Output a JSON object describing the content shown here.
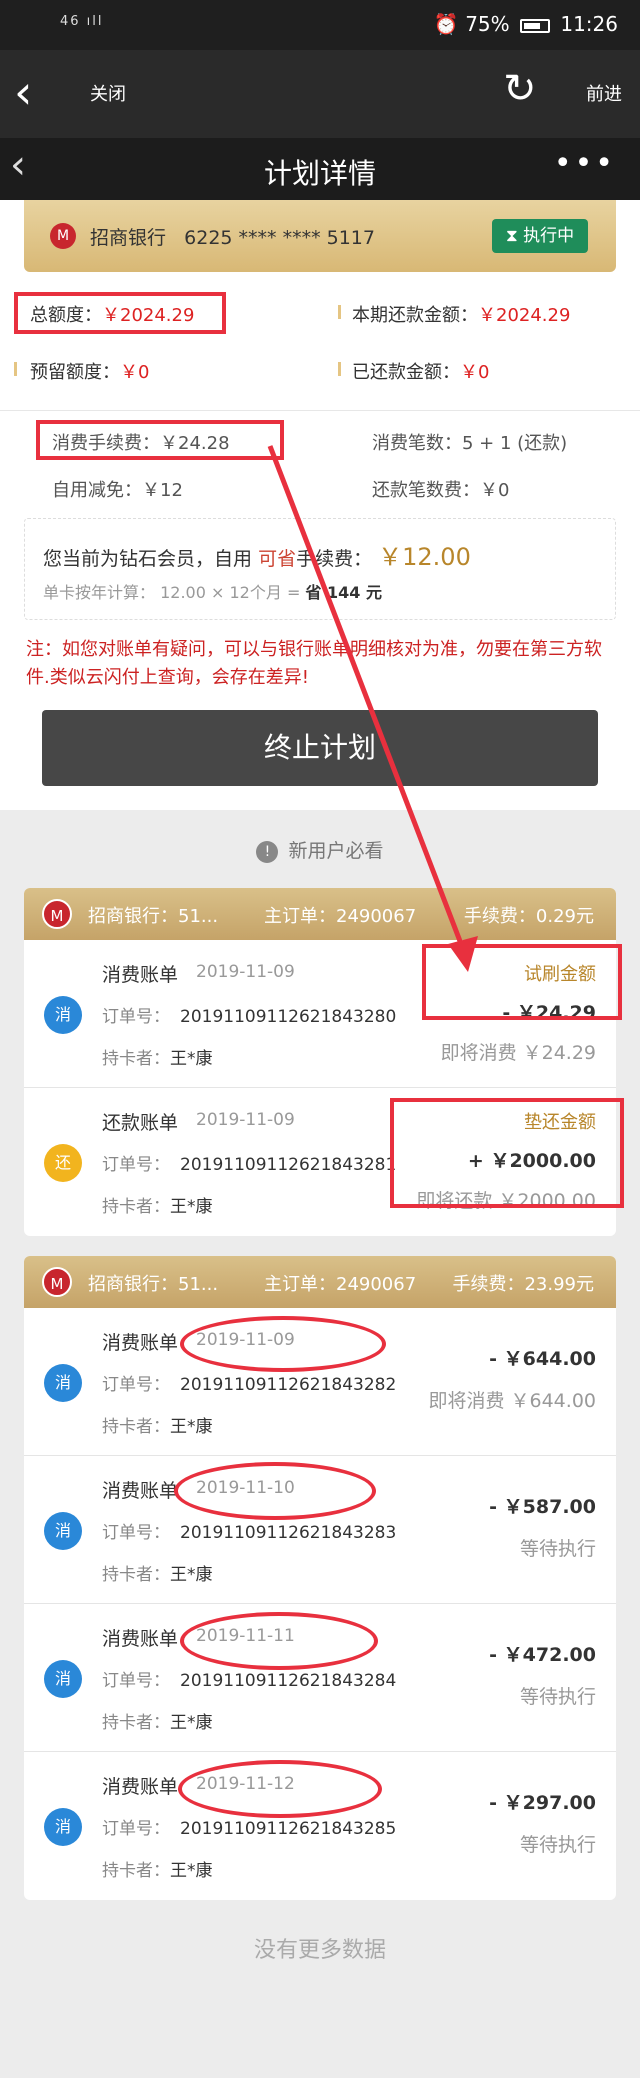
{
  "status_bar": {
    "signal": "46 ıll",
    "battery": "75%",
    "time": "11:26"
  },
  "browser": {
    "close": "关闭",
    "forward": "前进"
  },
  "header": {
    "title": "计划详情",
    "more": "•••"
  },
  "plan": {
    "bank_name": "招商银行",
    "card_number": "6225 **** **** 5117",
    "status": "执行中",
    "total_label": "总额度：",
    "total_value": "￥2024.29",
    "period_label": "本期还款金额：",
    "period_value": "￥2024.29",
    "reserve_label": "预留额度：",
    "reserve_value": "￥0",
    "repaid_label": "已还款金额：",
    "repaid_value": "￥0",
    "fee_label": "消费手续费：",
    "fee_value": "￥24.28",
    "count_label": "消费笔数：",
    "count_value": "5 + 1 (还款)",
    "self_label": "自用减免：",
    "self_value": "￥12",
    "repay_fee_label": "还款笔数费：",
    "repay_fee_value": "￥0"
  },
  "member": {
    "line1_a": "您当前为钻石会员，自用",
    "line1_b": "可省",
    "line1_c": "手续费：",
    "line1_amount": "￥12.00",
    "line2_a": "单卡按年计算：",
    "line2_b": "12.00 × 12个月 = ",
    "line2_c": "省 144 元"
  },
  "note": "注：如您对账单有疑问，可以与银行账单明细核对为准，勿要在第三方软件.类似云闪付上查询，会存在差异!",
  "stop_button": "终止计划",
  "new_user": "新用户必看",
  "groups": [
    {
      "bank": "招商银行：51...",
      "order": "主订单：2490067",
      "fee": "手续费：0.29元",
      "rows": [
        {
          "icon": "消",
          "title": "消费账单",
          "date": "2019-11-09",
          "order_label": "订单号：",
          "order": "20191109112621843280",
          "holder_label": "持卡者：",
          "holder": "王*康",
          "label": "试刷金额",
          "amount": "- ￥24.29",
          "sub": "即将消费 ￥24.29"
        },
        {
          "icon": "还",
          "title": "还款账单",
          "date": "2019-11-09",
          "order_label": "订单号：",
          "order": "20191109112621843281",
          "holder_label": "持卡者：",
          "holder": "王*康",
          "label": "垫还金额",
          "amount": "+ ￥2000.00",
          "sub": "即将还款 ￥2000.00"
        }
      ]
    },
    {
      "bank": "招商银行：51...",
      "order": "主订单：2490067",
      "fee": "手续费：23.99元",
      "rows": [
        {
          "icon": "消",
          "title": "消费账单",
          "date": "2019-11-09",
          "order_label": "订单号：",
          "order": "20191109112621843282",
          "holder_label": "持卡者：",
          "holder": "王*康",
          "amount": "- ￥644.00",
          "sub": "即将消费 ￥644.00"
        },
        {
          "icon": "消",
          "title": "消费账单",
          "date": "2019-11-10",
          "order_label": "订单号：",
          "order": "20191109112621843283",
          "holder_label": "持卡者：",
          "holder": "王*康",
          "amount": "- ￥587.00",
          "sub": "等待执行"
        },
        {
          "icon": "消",
          "title": "消费账单",
          "date": "2019-11-11",
          "order_label": "订单号：",
          "order": "20191109112621843284",
          "holder_label": "持卡者：",
          "holder": "王*康",
          "amount": "- ￥472.00",
          "sub": "等待执行"
        },
        {
          "icon": "消",
          "title": "消费账单",
          "date": "2019-11-12",
          "order_label": "订单号：",
          "order": "20191109112621843285",
          "holder_label": "持卡者：",
          "holder": "王*康",
          "amount": "- ￥297.00",
          "sub": "等待执行"
        }
      ]
    }
  ],
  "no_more": "没有更多数据",
  "colors": {
    "annotation": "#e8303e",
    "gold": "#c5a368",
    "price_red": "#d22"
  }
}
